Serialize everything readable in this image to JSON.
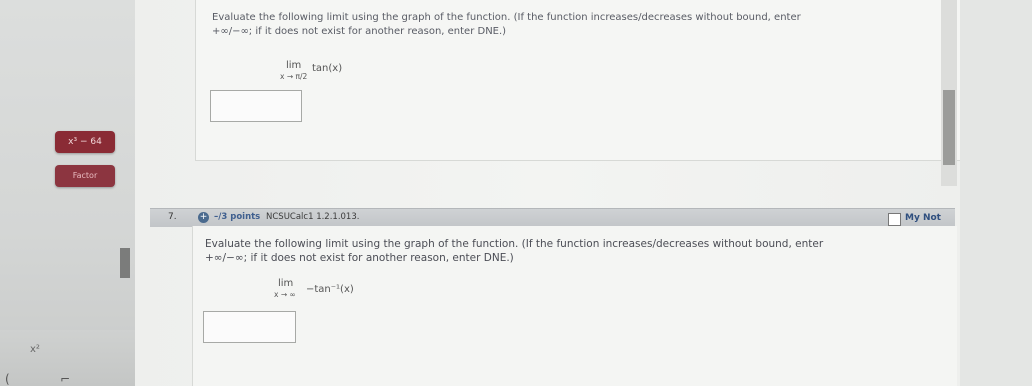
{
  "sidebar": {
    "expr_button": "x³ − 64",
    "factor_button": "Factor",
    "bottom_expr": "x²"
  },
  "question6": {
    "prompt_line1": "Evaluate the following limit using the graph of the function. (If the function increases/decreases without bound, enter",
    "prompt_line2": "+∞/−∞; if it does not exist for another reason, enter DNE.)",
    "limit_word": "lim",
    "limit_sub": "x → π/2",
    "function": "tan(x)",
    "answer_value": ""
  },
  "question7": {
    "number": "7.",
    "points": "–/3 points",
    "course": "NCSUCalc1 1.2.1.013.",
    "my_notes": "My Not",
    "prompt_line1": "Evaluate the following limit using the graph of the function. (If the function increases/decreases without bound, enter",
    "prompt_line2": "+∞/−∞; if it does not exist for another reason, enter DNE.)",
    "limit_word": "lim",
    "limit_sub": "x → ∞",
    "function": "−tan⁻¹(x)",
    "answer_value": ""
  },
  "colors": {
    "sidebar_button": "#8a2b35",
    "points_text": "#3f5f8f",
    "header_bar": "#c9ccce"
  }
}
